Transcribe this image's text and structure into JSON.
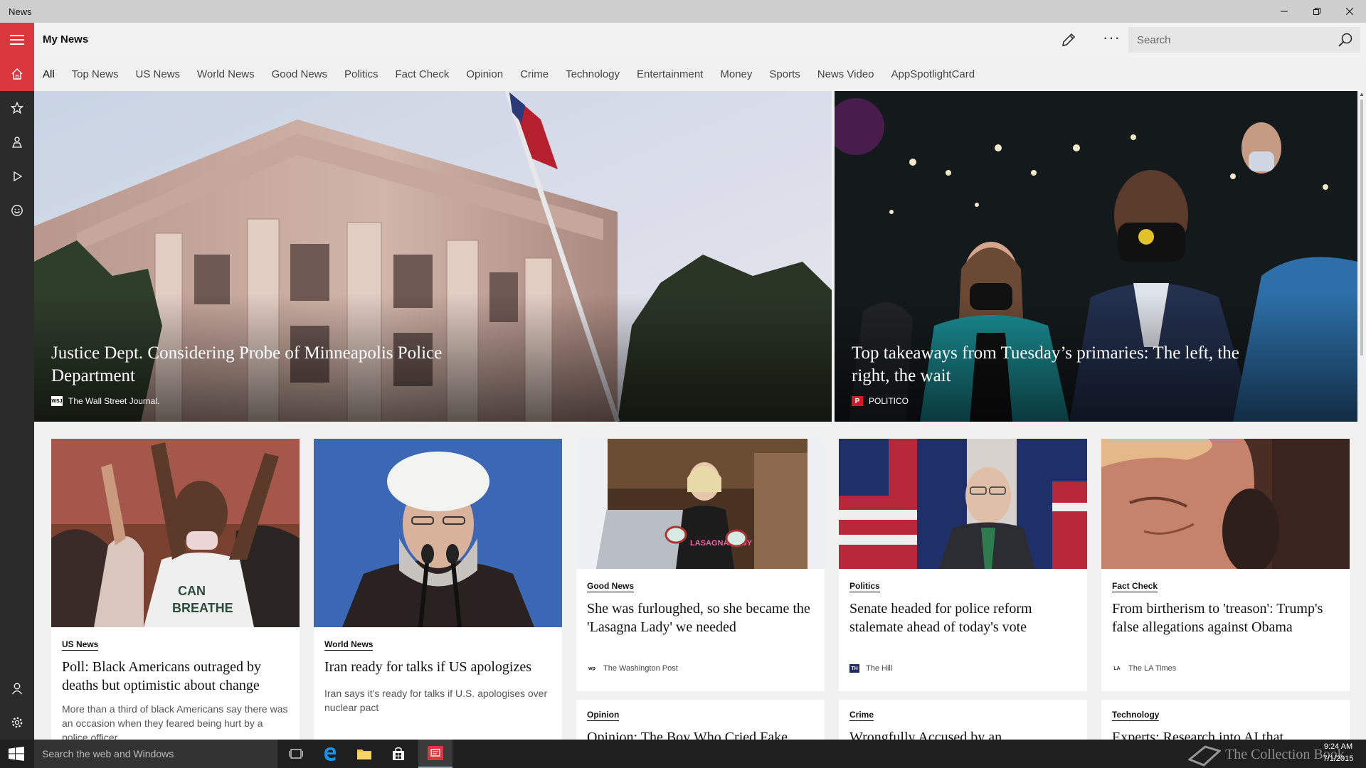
{
  "window": {
    "title": "News"
  },
  "appbar": {
    "title": "My News",
    "search_placeholder": "Search"
  },
  "tabs": [
    {
      "label": "All",
      "active": true
    },
    {
      "label": "Top News"
    },
    {
      "label": "US News"
    },
    {
      "label": "World News"
    },
    {
      "label": "Good News"
    },
    {
      "label": "Politics"
    },
    {
      "label": "Fact Check"
    },
    {
      "label": "Opinion"
    },
    {
      "label": "Crime"
    },
    {
      "label": "Technology"
    },
    {
      "label": "Entertainment"
    },
    {
      "label": "Money"
    },
    {
      "label": "Sports"
    },
    {
      "label": "News Video"
    },
    {
      "label": "AppSpotlightCard"
    }
  ],
  "sidebar": {
    "items": [
      {
        "icon": "home-icon",
        "active": true
      },
      {
        "icon": "star-icon"
      },
      {
        "icon": "local-icon"
      },
      {
        "icon": "video-icon"
      },
      {
        "icon": "smiley-icon"
      },
      {
        "icon": "user-icon"
      },
      {
        "icon": "gear-icon"
      }
    ]
  },
  "heroes": [
    {
      "headline": "Justice Dept. Considering Probe of Minneapolis Police Department",
      "source": "The Wall Street Journal.",
      "logo_text": "WSJ"
    },
    {
      "headline": "Top takeaways from Tuesday’s primaries: The left, the right, the wait",
      "source": "POLITICO",
      "logo_text": "P"
    }
  ],
  "cards": [
    {
      "category": "US News",
      "title": "Poll: Black Americans outraged by deaths but optimistic about change",
      "description": "More than a third of black Americans say there was an occasion when they feared being hurt by a police officer."
    },
    {
      "category": "World News",
      "title": "Iran ready for talks if US apologizes",
      "description": "Iran says it's ready for talks if U.S. apologises over nuclear pact"
    },
    {
      "category": "Good News",
      "title": "She was furloughed, so she became the 'Lasagna Lady' we needed",
      "source": "The Washington Post",
      "logo_text": "wp"
    },
    {
      "category": "Politics",
      "title": "Senate headed for police reform stalemate ahead of today's vote",
      "source": "The Hill",
      "logo_text": "TH"
    },
    {
      "category": "Fact Check",
      "title": "From birtherism to 'treason': Trump's false allegations against Obama",
      "source": "The LA Times",
      "logo_text": "LA"
    },
    {
      "category": "Opinion",
      "title": "Opinion: The Boy Who Cried Fake"
    },
    {
      "category": "Crime",
      "title": "Wrongfully Accused by an"
    },
    {
      "category": "Technology",
      "title": "Experts: Research into AI that"
    }
  ],
  "lasagna_sign": "LASAGNA LADY",
  "taskbar": {
    "search_text": "Search the web and Windows",
    "time": "9:24 AM",
    "date": "7/1/2015",
    "watermark": "The Collection Book"
  }
}
